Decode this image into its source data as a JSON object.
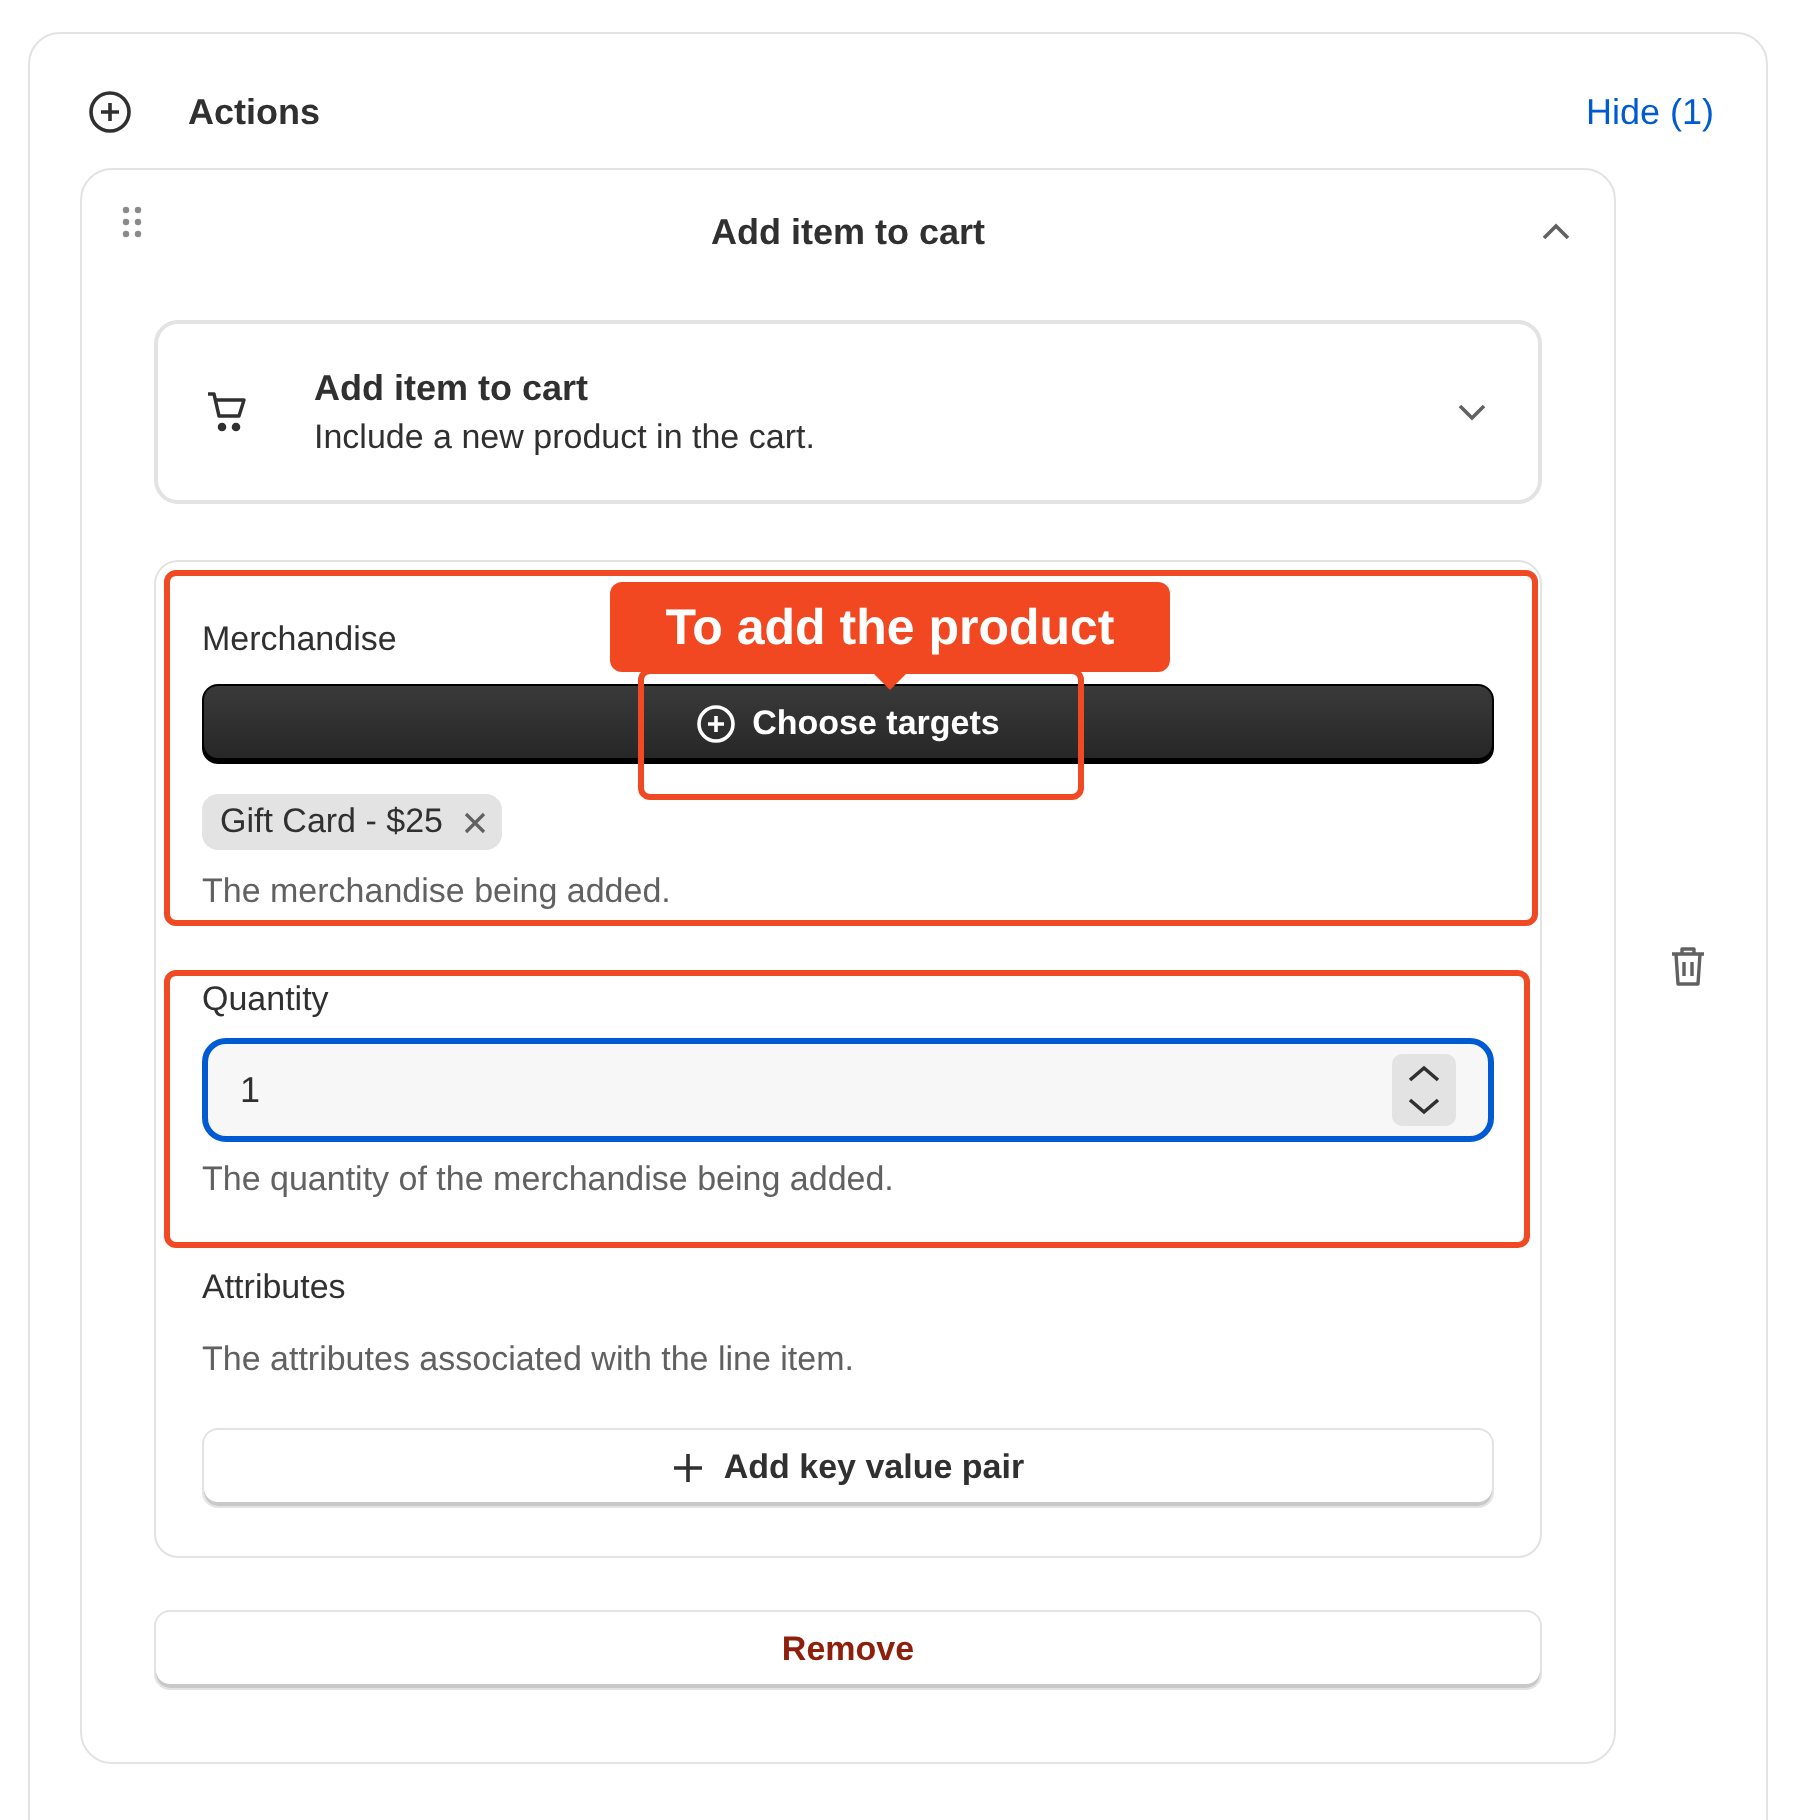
{
  "section": {
    "title": "Actions",
    "toggle": "Hide (1)"
  },
  "action_card": {
    "title": "Add item to cart",
    "expanded": true,
    "action_select": {
      "title": "Add item to cart",
      "description": "Include a new product in the cart."
    },
    "fields": [
      {
        "kind": "merchandise",
        "label": "Merchandise",
        "button": "Choose targets",
        "tags": [
          {
            "label": "Gift Card - $25"
          }
        ],
        "help": "The merchandise being added.",
        "highlighted": true,
        "button_highlighted": true,
        "callout": "To add the product"
      },
      {
        "kind": "number",
        "label": "Quantity",
        "value": "1",
        "focused": true,
        "help": "The quantity of the merchandise being added.",
        "highlighted": true
      },
      {
        "kind": "attributes",
        "label": "Attributes",
        "help": "The attributes associated with the line item.",
        "button": "Add key value pair",
        "highlighted": false
      }
    ],
    "remove_button": "Remove"
  }
}
